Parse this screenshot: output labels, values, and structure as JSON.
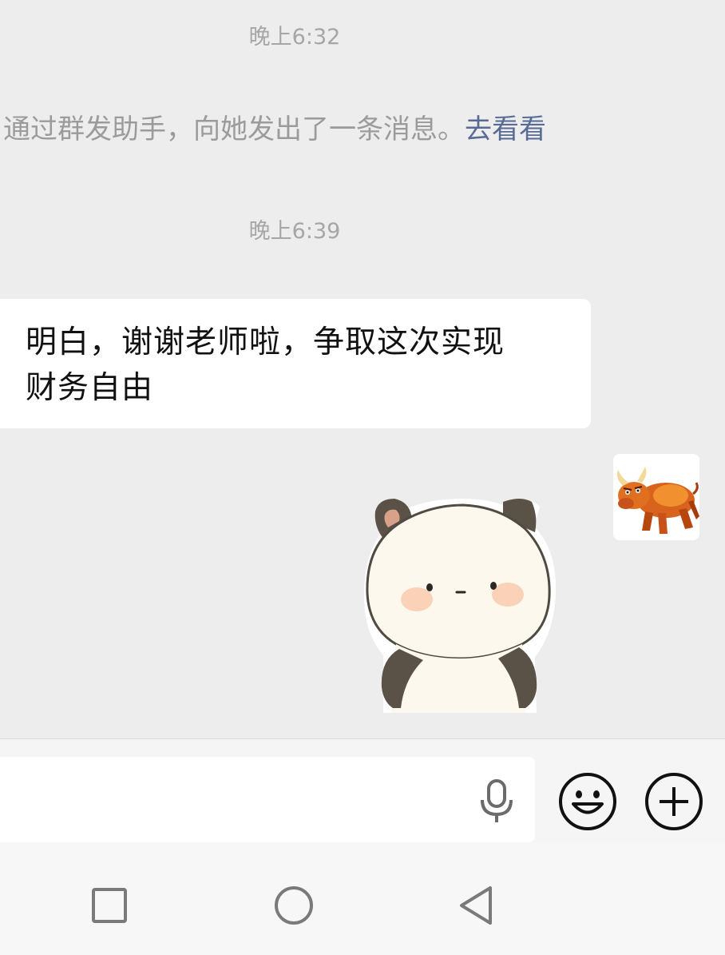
{
  "chat": {
    "timestamps": [
      "晚上6:32",
      "晚上6:39"
    ],
    "system_message": {
      "text": "通过群发助手，向她发出了一条消息。",
      "link": "去看看"
    },
    "incoming_message": {
      "line1": "明白，谢谢老师啦，争取这次实现",
      "line2": "财务自由"
    },
    "sent_sticker": "panda-sticker",
    "sender_avatar": "bull-avatar"
  },
  "input_bar": {
    "text_value": "",
    "icons": [
      "microphone-icon",
      "emoji-icon",
      "plus-icon"
    ]
  },
  "nav_bar": {
    "icons": [
      "recents-square-icon",
      "home-circle-icon",
      "back-triangle-icon"
    ]
  },
  "colors": {
    "chat_background": "#ededed",
    "bubble_background": "#ffffff",
    "link_color": "#576b95",
    "timestamp_color": "#a6a6a6",
    "icon_color": "#111111"
  }
}
